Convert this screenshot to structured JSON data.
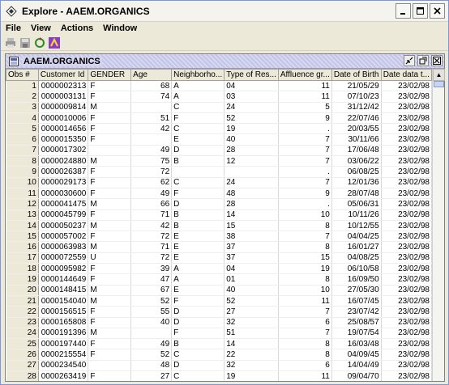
{
  "window": {
    "title": "Explore - AAEM.ORGANICS",
    "controls": [
      "minimize-icon",
      "maximize-icon",
      "close-icon"
    ]
  },
  "menubar": {
    "items": [
      {
        "label": "File"
      },
      {
        "label": "View"
      },
      {
        "label": "Actions"
      },
      {
        "label": "Window"
      }
    ]
  },
  "toolbar": {
    "icons": [
      "print-icon",
      "save-icon",
      "refresh-icon",
      "plot-wizard-icon"
    ]
  },
  "subwindow": {
    "title": "AAEM.ORGANICS",
    "controls": [
      "restore-icon",
      "maximize-icon",
      "close-icon"
    ]
  },
  "table": {
    "columns": [
      "Obs #",
      "Customer Id",
      "GENDER",
      "Age",
      "Neighborho...",
      "Type of Res...",
      "Affluence gr...",
      "Date of Birth",
      "Date data t..."
    ],
    "rows": [
      [
        "1",
        "0000002313",
        "F",
        "68",
        "A",
        "04",
        "11",
        "21/05/29",
        "23/02/98"
      ],
      [
        "2",
        "0000003131",
        "F",
        "74",
        "A",
        "03",
        "11",
        "07/10/23",
        "23/02/98"
      ],
      [
        "3",
        "0000009814",
        "M",
        "",
        "C",
        "24",
        "5",
        "31/12/42",
        "23/02/98"
      ],
      [
        "4",
        "0000010006",
        "F",
        "51",
        "F",
        "52",
        "9",
        "22/07/46",
        "23/02/98"
      ],
      [
        "5",
        "0000014656",
        "F",
        "42",
        "C",
        "19",
        ".",
        "20/03/55",
        "23/02/98"
      ],
      [
        "6",
        "0000015350",
        "F",
        "",
        "E",
        "40",
        "7",
        "30/11/66",
        "23/02/98"
      ],
      [
        "7",
        "0000017302",
        "",
        "49",
        "D",
        "28",
        "7",
        "17/06/48",
        "23/02/98"
      ],
      [
        "8",
        "0000024880",
        "M",
        "75",
        "B",
        "12",
        "7",
        "03/06/22",
        "23/02/98"
      ],
      [
        "9",
        "0000026387",
        "F",
        "72",
        "",
        "",
        ".",
        "06/08/25",
        "23/02/98"
      ],
      [
        "10",
        "0000029173",
        "F",
        "62",
        "C",
        "24",
        "7",
        "12/01/36",
        "23/02/98"
      ],
      [
        "11",
        "0000030600",
        "F",
        "49",
        "F",
        "48",
        "9",
        "28/07/48",
        "23/02/98"
      ],
      [
        "12",
        "0000041475",
        "M",
        "66",
        "D",
        "28",
        ".",
        "05/06/31",
        "23/02/98"
      ],
      [
        "13",
        "0000045799",
        "F",
        "71",
        "B",
        "14",
        "10",
        "10/11/26",
        "23/02/98"
      ],
      [
        "14",
        "0000050237",
        "M",
        "42",
        "B",
        "15",
        "8",
        "10/12/55",
        "23/02/98"
      ],
      [
        "15",
        "0000057002",
        "F",
        "72",
        "E",
        "38",
        "7",
        "04/04/25",
        "23/02/98"
      ],
      [
        "16",
        "0000063983",
        "M",
        "71",
        "E",
        "37",
        "8",
        "16/01/27",
        "23/02/98"
      ],
      [
        "17",
        "0000072559",
        "U",
        "72",
        "E",
        "37",
        "15",
        "04/08/25",
        "23/02/98"
      ],
      [
        "18",
        "0000095982",
        "F",
        "39",
        "A",
        "04",
        "19",
        "06/10/58",
        "23/02/98"
      ],
      [
        "19",
        "0000144649",
        "F",
        "47",
        "A",
        "01",
        "8",
        "16/09/50",
        "23/02/98"
      ],
      [
        "20",
        "0000148415",
        "M",
        "67",
        "E",
        "40",
        "10",
        "27/05/30",
        "23/02/98"
      ],
      [
        "21",
        "0000154040",
        "M",
        "52",
        "F",
        "52",
        "11",
        "16/07/45",
        "23/02/98"
      ],
      [
        "22",
        "0000156515",
        "F",
        "55",
        "D",
        "27",
        "7",
        "23/07/42",
        "23/02/98"
      ],
      [
        "23",
        "0000165808",
        "F",
        "40",
        "D",
        "32",
        "6",
        "25/08/57",
        "23/02/98"
      ],
      [
        "24",
        "0000191396",
        "M",
        "",
        "F",
        "51",
        "7",
        "19/07/54",
        "23/02/98"
      ],
      [
        "25",
        "0000197440",
        "F",
        "49",
        "B",
        "14",
        "8",
        "16/03/48",
        "23/02/98"
      ],
      [
        "26",
        "0000215554",
        "F",
        "52",
        "C",
        "22",
        "8",
        "04/09/45",
        "23/02/98"
      ],
      [
        "27",
        "0000234540",
        "",
        "48",
        "D",
        "32",
        "6",
        "14/04/49",
        "23/02/98"
      ],
      [
        "28",
        "0000263419",
        "F",
        "27",
        "C",
        "19",
        "11",
        "09/04/70",
        "23/02/98"
      ]
    ]
  }
}
